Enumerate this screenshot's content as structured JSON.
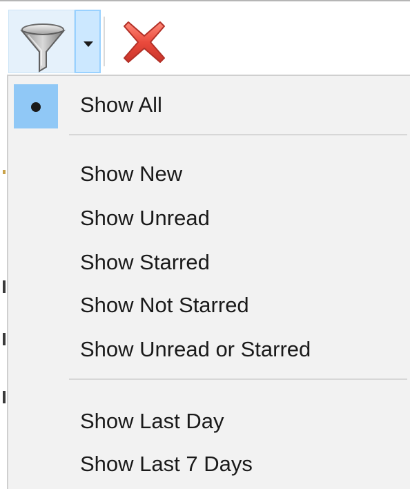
{
  "toolbar": {
    "filter_icon": "funnel-icon",
    "dropdown_icon": "chevron-down-icon",
    "clear_icon": "red-x-icon"
  },
  "menu": {
    "selected_index": 0,
    "groups": [
      {
        "items": [
          "Show All"
        ]
      },
      {
        "items": [
          "Show New",
          "Show Unread",
          "Show Starred",
          "Show Not Starred",
          "Show Unread or Starred"
        ]
      },
      {
        "items": [
          "Show Last Day",
          "Show Last 7 Days"
        ]
      }
    ]
  },
  "colors": {
    "selection": "#90c8f6",
    "dropdown_active": "#cce8ff",
    "clear_icon": "#e8473c",
    "menu_background": "#f2f2f2"
  }
}
